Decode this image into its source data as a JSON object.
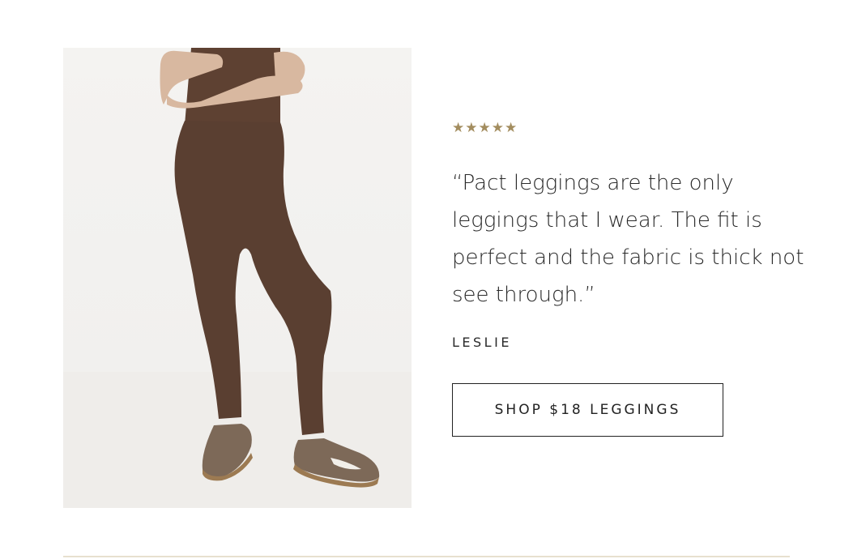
{
  "review": {
    "rating_stars": "★★★★★",
    "rating": 5,
    "quote": "“Pact leggings are the only leggings that I wear. The fit is perfect and the fabric is thick not see through.”",
    "author": "LESLIE"
  },
  "cta": {
    "label": "SHOP $18 LEGGINGS"
  },
  "colors": {
    "star": "#a38d5f",
    "legging": "#5a3f31",
    "text": "#2a2a2a",
    "divider": "#e7e0cf"
  }
}
